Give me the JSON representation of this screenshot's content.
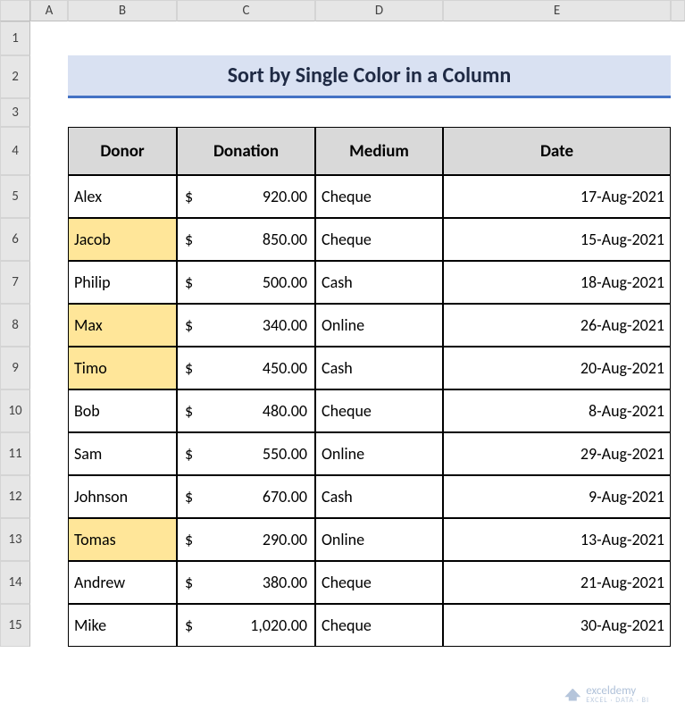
{
  "columns": [
    "A",
    "B",
    "C",
    "D",
    "E"
  ],
  "row_numbers": [
    "1",
    "2",
    "3",
    "4",
    "5",
    "6",
    "7",
    "8",
    "9",
    "10",
    "11",
    "12",
    "13",
    "14",
    "15"
  ],
  "title": "Sort by Single Color in a Column",
  "headers": {
    "donor": "Donor",
    "donation": "Donation",
    "medium": "Medium",
    "date": "Date"
  },
  "currency_symbol": "$",
  "rows": [
    {
      "donor": "Alex",
      "amount": "920.00",
      "medium": "Cheque",
      "date": "17-Aug-2021",
      "highlight": false
    },
    {
      "donor": "Jacob",
      "amount": "850.00",
      "medium": "Cheque",
      "date": "15-Aug-2021",
      "highlight": true
    },
    {
      "donor": "Philip",
      "amount": "500.00",
      "medium": "Cash",
      "date": "18-Aug-2021",
      "highlight": false
    },
    {
      "donor": "Max",
      "amount": "340.00",
      "medium": "Online",
      "date": "26-Aug-2021",
      "highlight": true
    },
    {
      "donor": "Timo",
      "amount": "450.00",
      "medium": "Cash",
      "date": "20-Aug-2021",
      "highlight": true
    },
    {
      "donor": "Bob",
      "amount": "480.00",
      "medium": "Cheque",
      "date": "8-Aug-2021",
      "highlight": false
    },
    {
      "donor": "Sam",
      "amount": "550.00",
      "medium": "Online",
      "date": "29-Aug-2021",
      "highlight": false
    },
    {
      "donor": "Johnson",
      "amount": "670.00",
      "medium": "Cash",
      "date": "9-Aug-2021",
      "highlight": false
    },
    {
      "donor": "Tomas",
      "amount": "290.00",
      "medium": "Online",
      "date": "13-Aug-2021",
      "highlight": true
    },
    {
      "donor": "Andrew",
      "amount": "380.00",
      "medium": "Cheque",
      "date": "21-Aug-2021",
      "highlight": false
    },
    {
      "donor": "Mike",
      "amount": "1,020.00",
      "medium": "Cheque",
      "date": "30-Aug-2021",
      "highlight": false
    }
  ],
  "watermark": {
    "brand": "exceldemy",
    "tagline": "EXCEL · DATA · BI"
  }
}
